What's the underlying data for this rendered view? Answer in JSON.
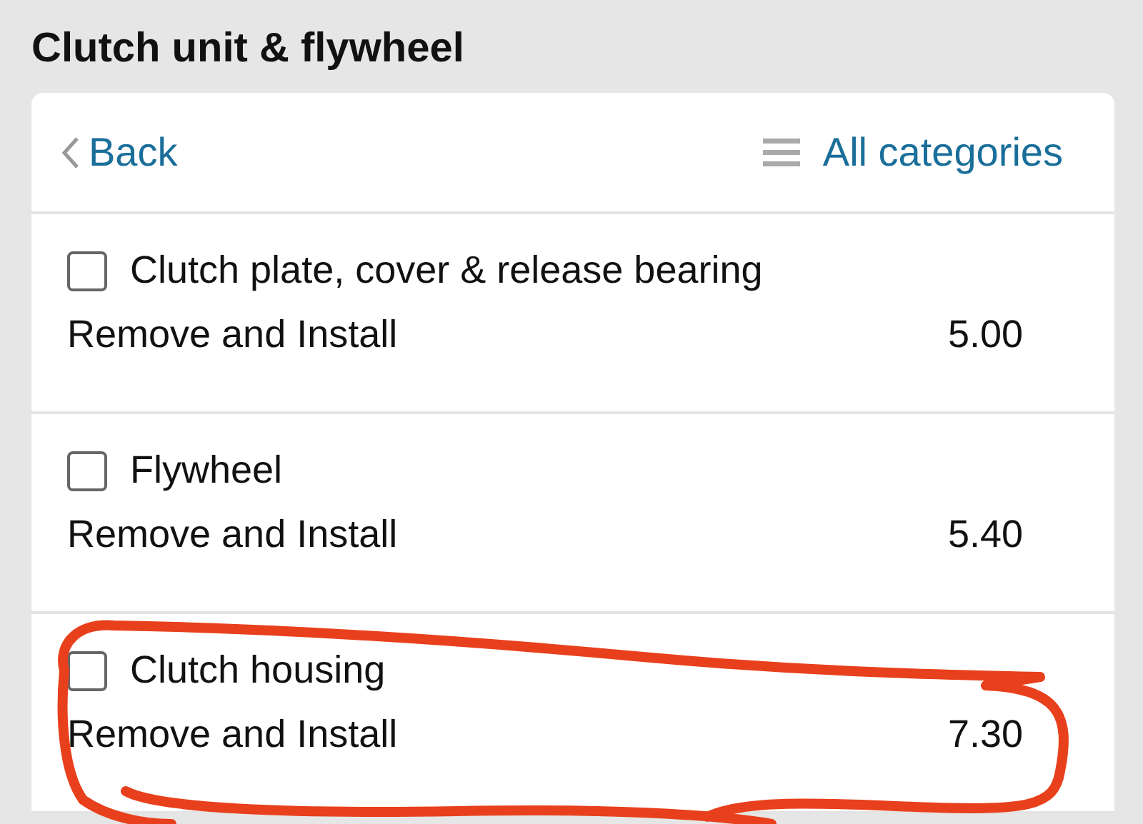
{
  "title": "Clutch unit & flywheel",
  "nav": {
    "back": "Back",
    "categories": "All categories"
  },
  "items": [
    {
      "name": "Clutch plate, cover & release bearing",
      "checked": false,
      "operation": "Remove and Install",
      "time": "5.00"
    },
    {
      "name": "Flywheel",
      "checked": false,
      "operation": "Remove and Install",
      "time": "5.40"
    },
    {
      "name": "Clutch housing",
      "checked": false,
      "operation": "Remove and Install",
      "time": "7.30"
    }
  ],
  "annotation": {
    "kind": "scribble",
    "color": "#e8401c"
  }
}
